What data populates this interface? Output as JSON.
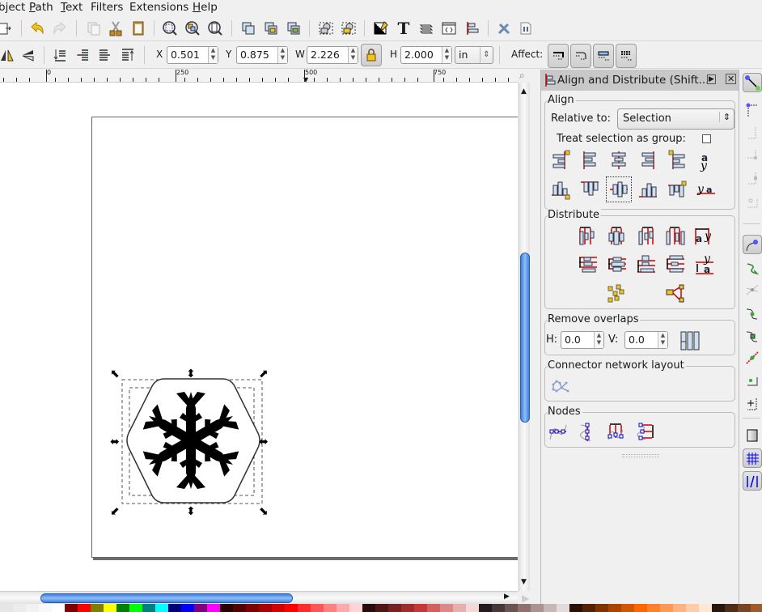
{
  "menu": [
    {
      "label": "bject",
      "u": ""
    },
    {
      "label": "Path",
      "u": "P"
    },
    {
      "label": "Text",
      "u": "T"
    },
    {
      "label": "Filters",
      "u": ""
    },
    {
      "label": "Extensions",
      "u": ""
    },
    {
      "label": "Help",
      "u": "H"
    }
  ],
  "commands": {
    "icons": [
      "import-icon",
      "undo-icon",
      "redo-icon",
      "duplicate-icon",
      "cut-icon",
      "paste-icon",
      "zoom-selection-icon",
      "zoom-drawing-icon",
      "zoom-page-icon",
      "clone-icon",
      "group-icon",
      "ungroup-icon",
      "raise-icon",
      "lower-icon",
      "fill-stroke-icon",
      "text-tool-icon",
      "layers-icon",
      "xml-editor-icon",
      "align-distribute-icon",
      "preferences-icon",
      "document-properties-icon"
    ]
  },
  "controls": {
    "x_label": "X",
    "x_value": "0.501",
    "y_label": "Y",
    "y_value": "0.875",
    "w_label": "W",
    "w_value": "2.226",
    "h_label": "H",
    "h_value": "2.000",
    "unit": "in",
    "lock_icon": "lock-icon",
    "affect_label": "Affect:"
  },
  "ruler": {
    "labels": [
      "0",
      "250",
      "500",
      "750"
    ]
  },
  "dock": {
    "title": "Align and Distribute (Shift...",
    "align": {
      "heading": "Align",
      "relative_label": "Relative to:",
      "relative_value": "Selection",
      "group_label": "Treat selection as group:",
      "group_checked": false
    },
    "distribute": {
      "heading": "Distribute"
    },
    "overlaps": {
      "heading": "Remove overlaps",
      "h_label": "H:",
      "h_value": "0.0",
      "v_label": "V:",
      "v_value": "0.0"
    },
    "connector": {
      "heading": "Connector network layout"
    },
    "nodes": {
      "heading": "Nodes"
    }
  },
  "colors": {
    "accent": "#3d7fe0",
    "palette": [
      "#e6e6e6",
      "#ececec",
      "#f2f2f2",
      "#f8f8f8",
      "#ffffff",
      "#800000",
      "#ff0000",
      "#808000",
      "#ffff00",
      "#008000",
      "#00ff00",
      "#008080",
      "#00ffff",
      "#000080",
      "#0000ff",
      "#800080",
      "#ff00ff",
      "#2b0000",
      "#550000",
      "#800000",
      "#aa0000",
      "#d40000",
      "#ff0000",
      "#ff2a2a",
      "#ff5555",
      "#ff8080",
      "#ffaaaa",
      "#ffd5d5",
      "#280b0b",
      "#501616",
      "#782121",
      "#a02c2c",
      "#c83737",
      "#d35f5f",
      "#de8787",
      "#e9afaf",
      "#f4d7d7",
      "#241c1c",
      "#483737",
      "#6c5353",
      "#916f6f",
      "#ac9393",
      "#c8b7b7",
      "#e3dbdb",
      "#2b1100",
      "#552200",
      "#803300",
      "#aa4400",
      "#d45500",
      "#ff6600",
      "#ff7f2a",
      "#ff9955",
      "#ffb380",
      "#ffccaa",
      "#ffe6d5",
      "#28170b",
      "#502d16",
      "#784421",
      "#a05a2c"
    ]
  }
}
